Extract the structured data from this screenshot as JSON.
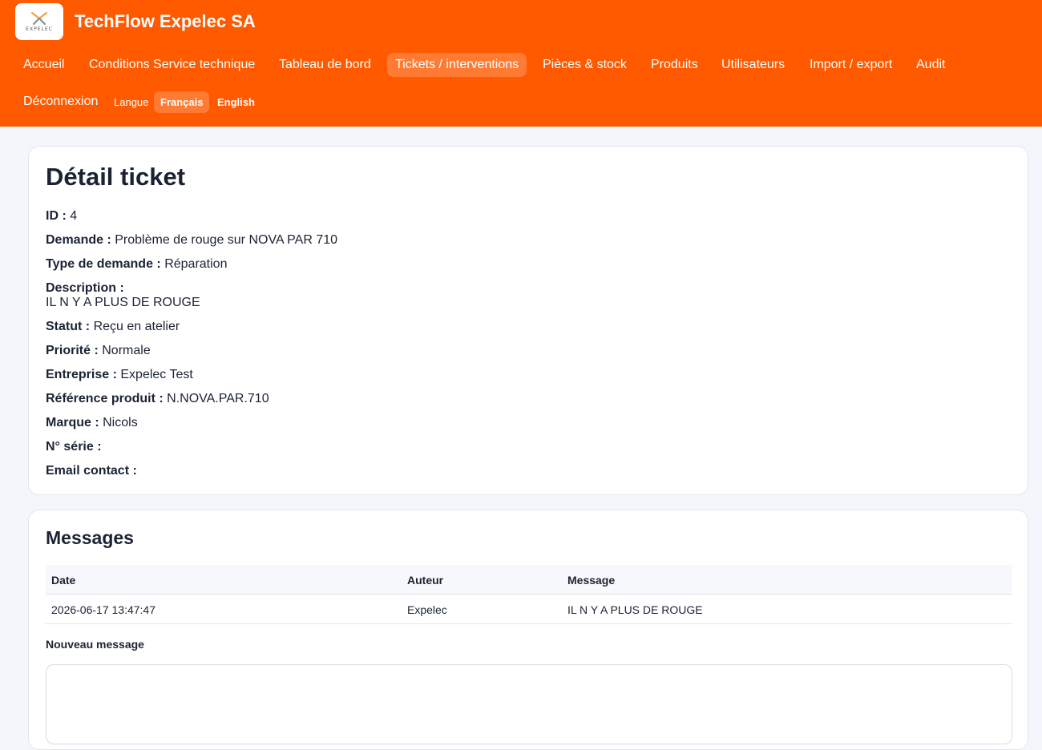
{
  "header": {
    "brand_title": "TechFlow Expelec SA",
    "logo_text": "EXPELEC",
    "accent_color": "#ff5a00"
  },
  "nav": {
    "items": [
      {
        "label": "Accueil"
      },
      {
        "label": "Conditions Service technique"
      },
      {
        "label": "Tableau de bord"
      },
      {
        "label": "Tickets / interventions",
        "active": true
      },
      {
        "label": "Pièces & stock"
      },
      {
        "label": "Produits"
      },
      {
        "label": "Utilisateurs"
      },
      {
        "label": "Import / export"
      },
      {
        "label": "Audit"
      },
      {
        "label": "Déconnexion"
      }
    ],
    "language_label": "Langue",
    "languages": [
      {
        "label": "Français",
        "active": true
      },
      {
        "label": "English"
      }
    ]
  },
  "ticket": {
    "title": "Détail ticket",
    "fields": [
      {
        "label": "ID :",
        "value": "4"
      },
      {
        "label": "Demande :",
        "value": "Problème de rouge sur NOVA PAR 710"
      },
      {
        "label": "Type de demande :",
        "value": "Réparation"
      },
      {
        "label": "Description :",
        "value": "IL N Y A PLUS DE ROUGE"
      },
      {
        "label": "Statut :",
        "value": "Reçu en atelier"
      },
      {
        "label": "Priorité :",
        "value": "Normale"
      },
      {
        "label": "Entreprise :",
        "value": "Expelec Test"
      },
      {
        "label": "Référence produit :",
        "value": "N.NOVA.PAR.710"
      },
      {
        "label": "Marque :",
        "value": "Nicols"
      },
      {
        "label": "N° série :",
        "value": ""
      },
      {
        "label": "Email contact :",
        "value": ""
      }
    ]
  },
  "messages": {
    "title": "Messages",
    "columns": [
      "Date",
      "Auteur",
      "Message"
    ],
    "rows": [
      [
        "2026-06-17 13:47:47",
        "Expelec",
        "IL N Y A PLUS DE ROUGE"
      ]
    ],
    "new_message_label": "Nouveau message",
    "new_message_value": ""
  }
}
